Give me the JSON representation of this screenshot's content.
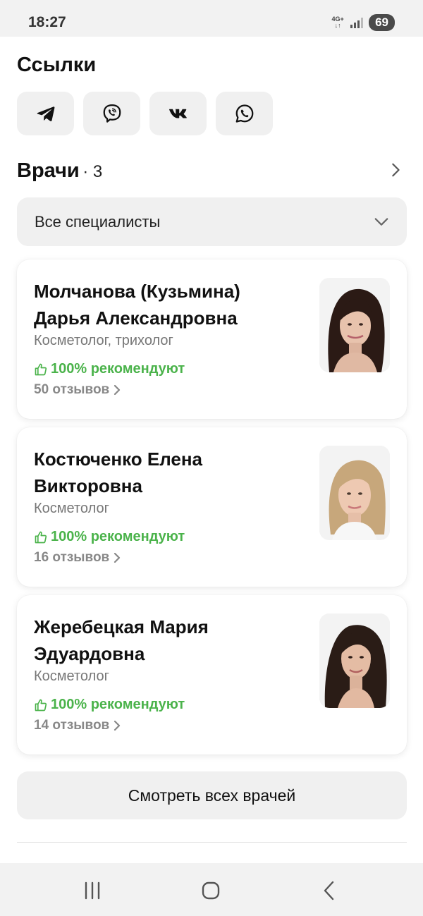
{
  "status_bar": {
    "time": "18:27",
    "network_top": "4G+",
    "battery": "69"
  },
  "links": {
    "title": "Ссылки",
    "items": [
      {
        "icon": "telegram-icon"
      },
      {
        "icon": "viber-icon"
      },
      {
        "icon": "vk-icon"
      },
      {
        "icon": "whatsapp-icon"
      }
    ]
  },
  "doctors": {
    "title": "Врачи",
    "count": "· 3",
    "filter": "Все специалисты",
    "items": [
      {
        "name": "Молчанова (Кузьмина) Дарья Александровна",
        "specialty": "Косметолог, трихолог",
        "recommend": "100% рекомендуют",
        "reviews": "50 отзывов"
      },
      {
        "name": "Костюченко Елена Викторовна",
        "specialty": "Косметолог",
        "recommend": "100% рекомендуют",
        "reviews": "16 отзывов"
      },
      {
        "name": "Жеребецкая Мария Эдуардовна",
        "specialty": "Косметолог",
        "recommend": "100% рекомендуют",
        "reviews": "14 отзывов"
      }
    ],
    "all_button": "Смотреть всех врачей"
  },
  "colors": {
    "recommend_green": "#4bb34b",
    "button_bg": "#f0f0f0"
  }
}
